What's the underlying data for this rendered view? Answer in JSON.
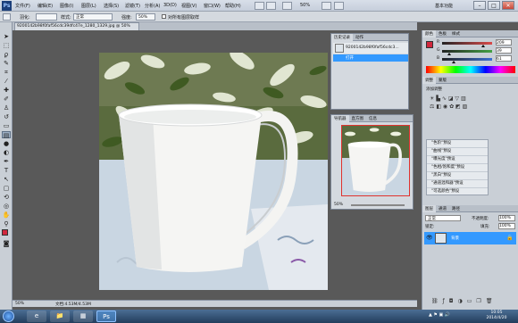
{
  "menu": {
    "logo": "Ps",
    "items": [
      "文件(F)",
      "编辑(E)",
      "图像(I)",
      "图层(L)",
      "选择(S)",
      "滤镜(T)",
      "分析(A)",
      "3D(D)",
      "视图(V)",
      "窗口(W)",
      "帮助(H)"
    ],
    "zoom": "50%",
    "workspace": "基本功能",
    "min": "–",
    "max": "□",
    "close": "✕"
  },
  "options": {
    "feather_label": "羽化:",
    "feather_value": "",
    "style_label": "样式:",
    "style_value": "正常",
    "mode_label": "强度:",
    "mode_value": "50%",
    "sample_all_label": "对所有图层取样"
  },
  "document": {
    "tab_title": "9200142b98f0faf56cdc39dfc47e_1280_1329.jpg @ 50%(RGB/8#)",
    "zoom": "50%",
    "doc_info": "文档:4.53M/4.53M"
  },
  "history_panel": {
    "tabs": [
      "历史记录",
      "动作"
    ],
    "snapshot_name": "9200142b98f0faf56cdc3...",
    "steps": [
      "打开"
    ]
  },
  "navigator_panel": {
    "tabs": [
      "导航器",
      "直方图",
      "信息"
    ],
    "zoom": "50%"
  },
  "color_panel": {
    "tabs": [
      "颜色",
      "色板",
      "样式"
    ],
    "channels": [
      {
        "label": "R",
        "value": "209",
        "color": "#d94a4a",
        "level": 0.82
      },
      {
        "label": "G",
        "value": "39",
        "color": "#44a244",
        "level": 0.15
      },
      {
        "label": "B",
        "value": "61",
        "color": "#3d6fd1",
        "level": 0.24
      }
    ]
  },
  "adjustments_panel": {
    "tabs": [
      "调整",
      "蒙版"
    ],
    "title": "添加调整",
    "presets": [
      "\"色阶\"预设",
      "\"曲线\"预设",
      "\"曝光度\"预设",
      "\"色相/饱和度\"预设",
      "\"黑白\"预设",
      "\"通道混和器\"预设",
      "\"可选颜色\"预设"
    ]
  },
  "layers_panel": {
    "tabs": [
      "图层",
      "通道",
      "路径"
    ],
    "blend_mode": "正常",
    "opacity_label": "不透明度:",
    "opacity_value": "100%",
    "lock_label": "锁定:",
    "fill_label": "填充:",
    "fill_value": "100%",
    "layers": [
      {
        "name": "背景"
      }
    ]
  },
  "taskbar": {
    "time": "10:05",
    "date": "2014/4/20",
    "apps": [
      "e",
      "📁",
      "▦",
      "Ps"
    ]
  },
  "colors": {
    "foreground": "#d1273d",
    "background": "#ffffff",
    "selection": "#3399ff"
  }
}
